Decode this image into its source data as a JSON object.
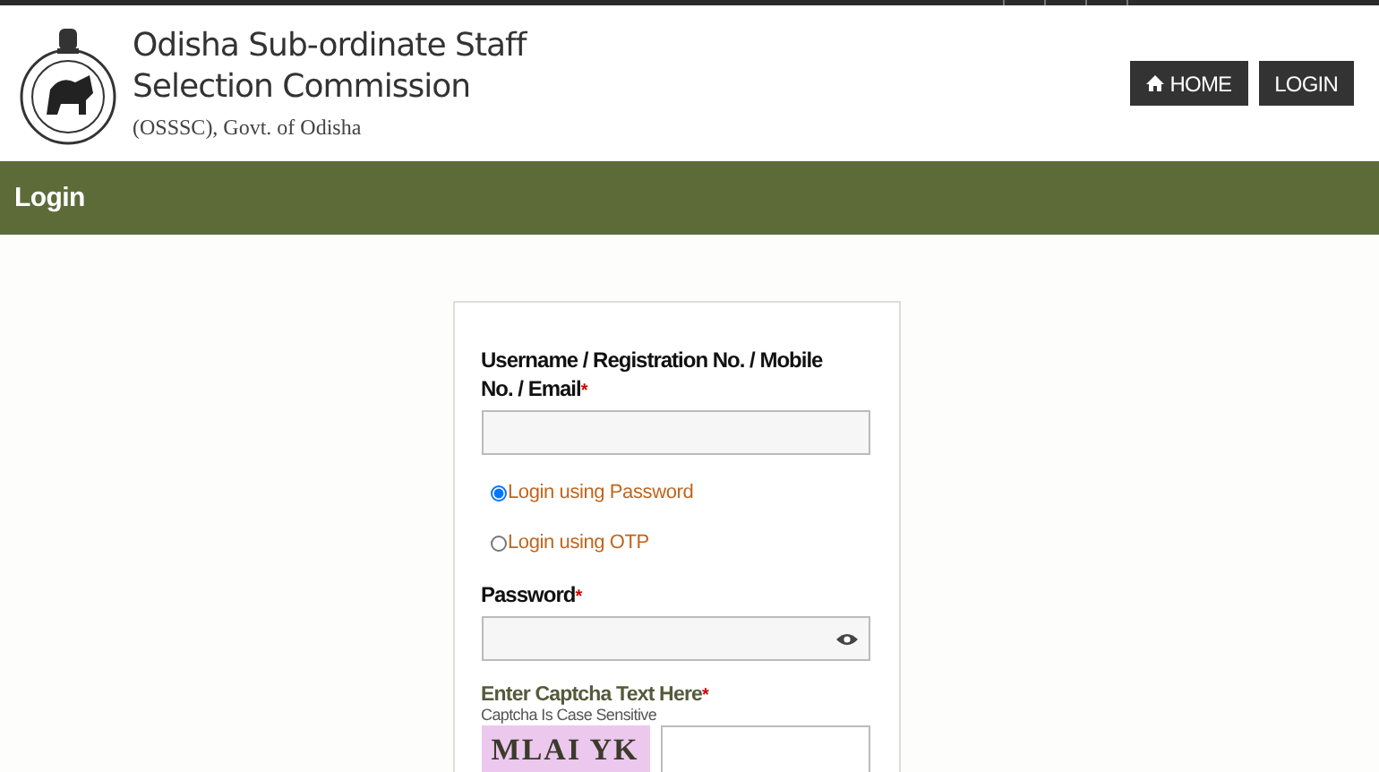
{
  "header": {
    "title_line1": "Odisha Sub-ordinate Staff",
    "title_line2": "Selection Commission",
    "subtitle": "(OSSSC), Govt. of Odisha",
    "nav": [
      {
        "label": "HOME",
        "kind": "home"
      },
      {
        "label": "LOGIN",
        "kind": "plain"
      }
    ]
  },
  "page_title": "Login",
  "form": {
    "username_label": "Username / Registration No. / Mobile No. / Email",
    "required_mark": "*",
    "login_modes": [
      {
        "label": "Login using Password",
        "selected": true
      },
      {
        "label": "Login using OTP",
        "selected": false
      }
    ],
    "password_label": "Password",
    "captcha_label": "Enter Captcha Text Here",
    "captcha_note": "Captcha Is Case Sensitive",
    "captcha_text": "MLAI YK"
  }
}
